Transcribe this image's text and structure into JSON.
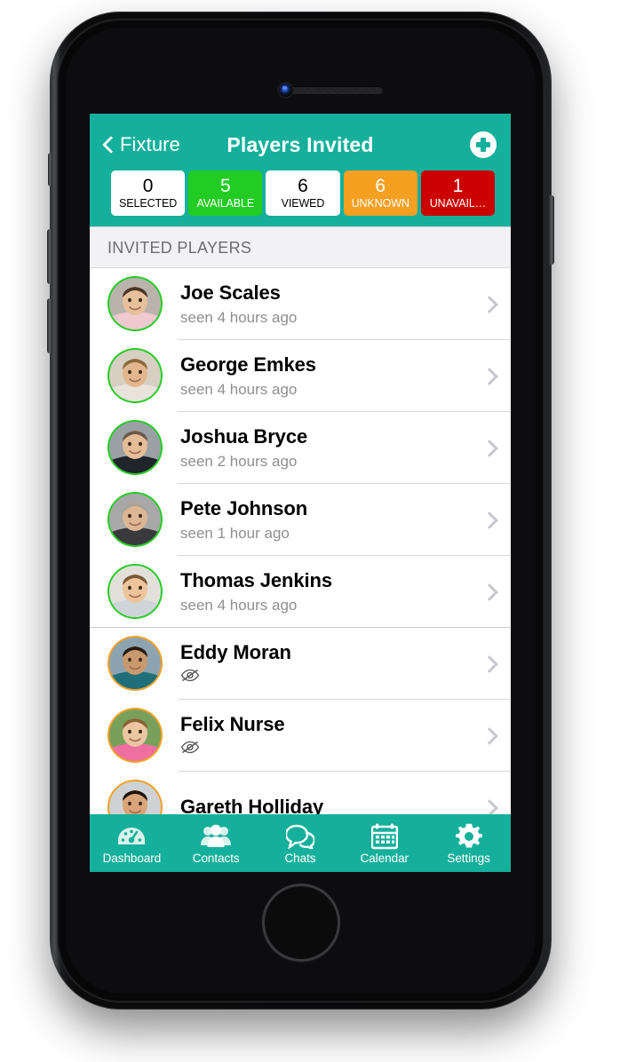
{
  "theme": {
    "teal": "#15b09b",
    "green": "#22cc22",
    "orange": "#f5a020",
    "red": "#cc0000",
    "chevron_gray": "#c7c7cc",
    "section_bg": "#f2f2f4",
    "subtitle_gray": "#8e8e93"
  },
  "navbar": {
    "back_label": "Fixture",
    "back_icon": "chevron-left-icon",
    "title": "Players Invited",
    "add_icon": "plus-circle-icon"
  },
  "stats": [
    {
      "value": "0",
      "label": "SELECTED",
      "style": "white"
    },
    {
      "value": "5",
      "label": "AVAILABLE",
      "style": "green"
    },
    {
      "value": "6",
      "label": "VIEWED",
      "style": "white"
    },
    {
      "value": "6",
      "label": "UNKNOWN",
      "style": "orange"
    },
    {
      "value": "1",
      "label": "UNAVAIL…",
      "style": "red"
    }
  ],
  "section": {
    "header": "INVITED PLAYERS"
  },
  "players": [
    {
      "name": "Joe Scales",
      "subtitle": "seen 4 hours ago",
      "ring": "green",
      "sub_icon": null,
      "group_end": false,
      "skin": "#e7c19b",
      "hair": "#4a3426",
      "bg": "#b9b3ab",
      "shirt": "#f0c8cf"
    },
    {
      "name": "George Emkes",
      "subtitle": "seen 4 hours ago",
      "ring": "green",
      "sub_icon": null,
      "group_end": false,
      "skin": "#e3b78e",
      "hair": "#8a6a3f",
      "bg": "#d6cfc2",
      "shirt": "#e8e4dc"
    },
    {
      "name": "Joshua Bryce",
      "subtitle": "seen 2 hours ago",
      "ring": "green",
      "sub_icon": null,
      "group_end": false,
      "skin": "#e5bd96",
      "hair": "#6b594a",
      "bg": "#9aa0a3",
      "shirt": "#20242b"
    },
    {
      "name": "Pete Johnson",
      "subtitle": "seen 1 hour ago",
      "ring": "green",
      "sub_icon": null,
      "group_end": false,
      "skin": "#ddb795",
      "hair": "#a9a29a",
      "bg": "#a8a8a8",
      "shirt": "#3a3a3c"
    },
    {
      "name": "Thomas Jenkins",
      "subtitle": "seen 4 hours ago",
      "ring": "green",
      "sub_icon": null,
      "group_end": true,
      "skin": "#edc49c",
      "hair": "#7a5a36",
      "bg": "#e3e0da",
      "shirt": "#cfd4d8"
    },
    {
      "name": "Eddy Moran",
      "subtitle": "",
      "ring": "orange",
      "sub_icon": "eye-slash-icon",
      "group_end": false,
      "skin": "#c9996e",
      "hair": "#241a14",
      "bg": "#8ea3b0",
      "shirt": "#1f6f7a"
    },
    {
      "name": "Felix Nurse",
      "subtitle": "",
      "ring": "orange",
      "sub_icon": "eye-slash-icon",
      "group_end": false,
      "skin": "#eac7a2",
      "hair": "#8a6134",
      "bg": "#79a05a",
      "shirt": "#ef6fa0"
    },
    {
      "name": "Gareth Holliday",
      "subtitle": "",
      "ring": "orange",
      "sub_icon": null,
      "group_end": false,
      "skin": "#d9a578",
      "hair": "#1d1510",
      "bg": "#cfd2d4",
      "shirt": "#2b2b2e"
    }
  ],
  "tabs": [
    {
      "label": "Dashboard",
      "icon": "dashboard-gauge-icon"
    },
    {
      "label": "Contacts",
      "icon": "contacts-people-icon"
    },
    {
      "label": "Chats",
      "icon": "chat-bubbles-icon"
    },
    {
      "label": "Calendar",
      "icon": "calendar-icon"
    },
    {
      "label": "Settings",
      "icon": "gear-icon"
    }
  ]
}
